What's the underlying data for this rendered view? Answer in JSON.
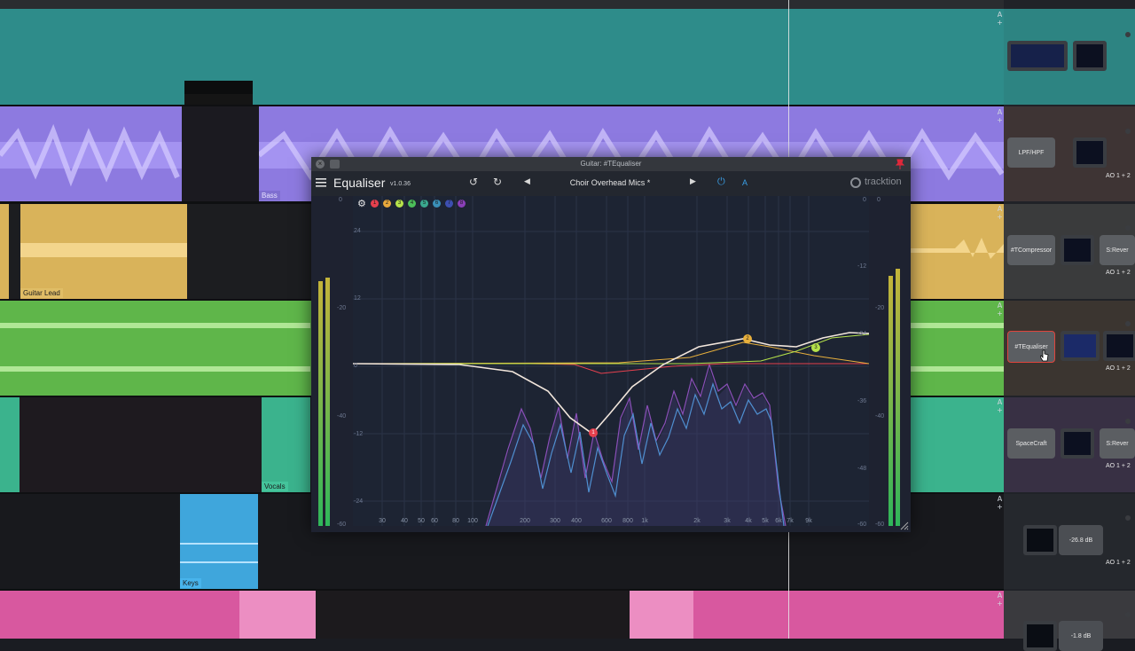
{
  "colors": {
    "track_teal": "#2e8c8a",
    "track_purple": "#9b88e8",
    "track_yellow": "#d9b35a",
    "track_green": "#5fb64a",
    "track_mint": "#3bb38d",
    "track_blue": "#3fa6dc",
    "track_pink": "#d8589f",
    "eq_curve": "#f2e6dc",
    "band1": "#e5404e",
    "band2": "#e8b03c",
    "band3": "#b6e24a"
  },
  "tracks": {
    "clip_bass": "Bass",
    "clip_guitar_lead": "Guitar Lead",
    "clip_vocals": "Vocals",
    "clip_keys": "Keys",
    "btn_a": "A",
    "btn_plus": "+"
  },
  "rack": {
    "lpf_hpf": "LPF/HPF",
    "tcompressor": "#TCompressor",
    "sreverb": "S:Rever",
    "tequaliser": "#TEqualiser",
    "spacecraft": "SpaceCraft",
    "sreverb2": "S:Rever",
    "volume_db": "-26.8 dB",
    "volume_db2": "-1.8 dB",
    "output": "AO 1 + 2"
  },
  "plugin": {
    "window_title": "Guitar: #TEqualiser",
    "name": "Equaliser",
    "version": "v1.0.36",
    "preset": "Choir Overhead Mics *",
    "ab_label": "A",
    "brand": "tracktion",
    "band_numbers": [
      "1",
      "2",
      "3",
      "4",
      "5",
      "6",
      "7",
      "8"
    ],
    "band_colors": [
      "#e5404e",
      "#e8a83c",
      "#b6e24a",
      "#4cbf5a",
      "#3aa88f",
      "#3a8fb8",
      "#3d4fb0",
      "#8a3fb8"
    ],
    "gain_labels": [
      "24",
      "12",
      "0",
      "-12",
      "-24"
    ],
    "meter_left_labels": [
      "0",
      "-20",
      "-40",
      "-60"
    ],
    "meter_right_labels": [
      "0",
      "-12",
      "-24",
      "-36",
      "-48",
      "-60"
    ],
    "meter_right_outer": [
      "0",
      "-20",
      "-40",
      "-60"
    ],
    "freq_labels": [
      "30",
      "40",
      "50",
      "60",
      "80",
      "100",
      "200",
      "300",
      "400",
      "600",
      "800",
      "1k",
      "2k",
      "3k",
      "4k",
      "5k",
      "6k",
      "7k",
      "9k"
    ],
    "band_markers": [
      "1",
      "2",
      "3"
    ]
  }
}
